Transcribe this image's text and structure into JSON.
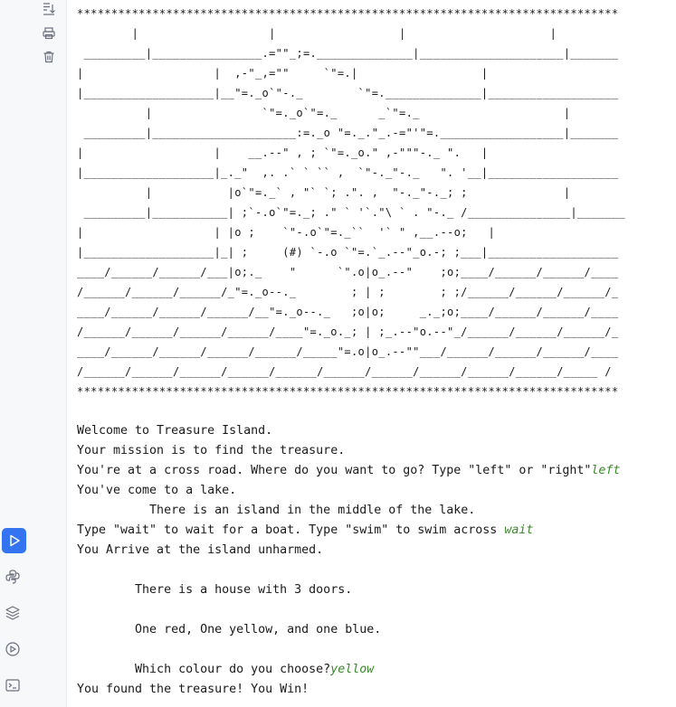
{
  "gutter": {
    "top_icons": [
      {
        "name": "scroll-to-end-icon",
        "label": "Scroll to the end"
      },
      {
        "name": "print-icon",
        "label": "Print"
      },
      {
        "name": "trash-icon",
        "label": "Clear all"
      }
    ],
    "bottom_icons": [
      {
        "name": "run-icon",
        "label": "Run",
        "active": true
      },
      {
        "name": "python-console-icon",
        "label": "Python Console"
      },
      {
        "name": "python-packages-icon",
        "label": "Python Packages"
      },
      {
        "name": "services-icon",
        "label": "Services"
      },
      {
        "name": "terminal-icon",
        "label": "Terminal"
      }
    ],
    "accent_color": "#3574f0"
  },
  "console": {
    "ascii_art": "*******************************************************************************\n        |                   |                  |                     |\n _________|________________.=\"\"_;=.______________|_____________________|_______\n|                   |  ,-\"_,=\"\"     `\"=.|                  |\n|___________________|__\"=._o`\"-._        `\"=.______________|___________________\n          |                `\"=._o`\"=._      _`\"=._                     |\n _________|_____________________:=._o \"=._.\"_.-=\"'\"=.__________________|_______\n|                   |    __.--\" , ; `\"=._o.\" ,-\"\"\"-._ \".   |\n|___________________|_._\"  ,. .` ` `` ,  `\"-._\"-._   \". '__|___________________\n          |           |o`\"=._` , \"` `; .\". ,  \"-._\"-._; ;              |\n _________|___________| ;`-.o`\"=._; .\" ` '`.\"\\ ` . \"-._ /_______________|_______\n|                   | |o ;    `\"-.o`\"=._``  '` \" ,__.--o;   |\n|___________________|_| ;     (#) `-.o `\"=.`_.--\"_o.-; ;___|___________________\n____/______/______/___|o;._    \"      `\".o|o_.--\"    ;o;____/______/______/____\n/______/______/______/_\"=._o--._        ; | ;        ; ;/______/______/______/_\n____/______/______/______/__\"=._o--._   ;o|o;     _._;o;____/______/______/____\n/______/______/______/______/____\"=._o._; | ;_.--\"o.--\"_/______/______/______/_\n____/______/______/______/______/_____\"=.o|o_.--\"\"___/______/______/______/____\n/______/______/______/______/______/______/______/______/______/______/_____ /\n*******************************************************************************",
    "lines": [
      {
        "text": "Welcome to Treasure Island.",
        "input": ""
      },
      {
        "text": "Your mission is to find the treasure.",
        "input": ""
      },
      {
        "text": "You're at a cross road. Where do you want to go? Type \"left\" or \"right\"",
        "input": "left"
      },
      {
        "text": "You've come to a lake.",
        "input": ""
      },
      {
        "text": "          There is an island in the middle of the lake.",
        "input": ""
      },
      {
        "text": "Type \"wait\" to wait for a boat. Type \"swim\" to swim across ",
        "input": "wait"
      },
      {
        "text": "You Arrive at the island unharmed.",
        "input": ""
      },
      {
        "text": "",
        "input": ""
      },
      {
        "text": "        There is a house with 3 doors.",
        "input": ""
      },
      {
        "text": "",
        "input": ""
      },
      {
        "text": "        One red, One yellow, and one blue.",
        "input": ""
      },
      {
        "text": "",
        "input": ""
      },
      {
        "text": "        Which colour do you choose?",
        "input": "yellow"
      },
      {
        "text": "You found the treasure! You Win!",
        "input": ""
      }
    ],
    "input_color": "#3a8a2a"
  }
}
